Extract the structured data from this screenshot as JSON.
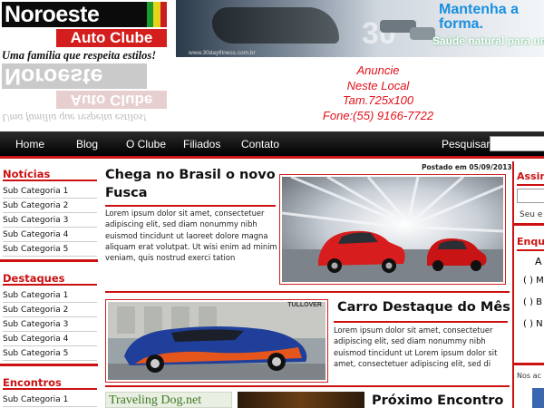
{
  "header": {
    "logo": {
      "main": "Noroeste",
      "sub": "Auto Clube",
      "slogan": "Uma família que respeita estilos!"
    },
    "banner": {
      "title": "Mantenha a forma.",
      "subtitle": "Saúde natural para um",
      "url": "www.30dayfitness.com.br"
    },
    "ad": {
      "lines": [
        "Anuncie",
        "Neste Local",
        "Tam.725x100",
        "Fone:(55) 9166-7722"
      ]
    }
  },
  "nav": {
    "items": [
      "Home",
      "Blog",
      "O Clube",
      "Filiados",
      "Contato"
    ],
    "search_label": "Pesquisar",
    "search_value": ""
  },
  "sidebar": {
    "sections": [
      {
        "title": "Notícias",
        "items": [
          "Sub Categoria 1",
          "Sub Categoria 2",
          "Sub Categoria 3",
          "Sub Categoria 4",
          "Sub Categoria 5"
        ]
      },
      {
        "title": "Destaques",
        "items": [
          "Sub Categoria 1",
          "Sub Categoria 2",
          "Sub Categoria 3",
          "Sub Categoria 4",
          "Sub Categoria 5"
        ]
      },
      {
        "title": "Encontros",
        "items": [
          "Sub Categoria 1"
        ]
      }
    ]
  },
  "main": {
    "posted": "Postado em 05/09/2013",
    "article1": {
      "title_line1": "Chega no Brasil o novo",
      "title_line2": "Fusca",
      "text": "Lorem ipsum dolor sit amet, consectetuer adipiscing elit, sed diam nonummy nibh euismod tincidunt ut laoreet dolore magna aliquam erat volutpat. Ut wisi enim ad minim veniam, quis nostrud exerci tation"
    },
    "article2": {
      "title": "Carro Destaque do Mês",
      "text": "Lorem ipsum dolor sit amet, consectetuer adipiscing elit, sed diam nonummy nibh euismod tincidunt ut Lorem ipsum dolor sit amet, consectetuer adipiscing elit, sed di",
      "image_caption": "TULLOVER"
    },
    "article3": {
      "title": "Próximo Encontro",
      "thumb_text": "Traveling Dog.net"
    }
  },
  "right": {
    "assine_label": "Assine",
    "assine_text": "Seu e",
    "enquete_label": "Enque",
    "enquete_options": [
      "( ) M",
      "( ) B",
      "( ) N"
    ],
    "enquete_letter": "A",
    "nos_label": "Nos ac"
  },
  "colors": {
    "accent": "#cc1616",
    "nav_bg": "#000000",
    "ad_text": "#e0121b",
    "banner_title": "#1a8fe0"
  }
}
